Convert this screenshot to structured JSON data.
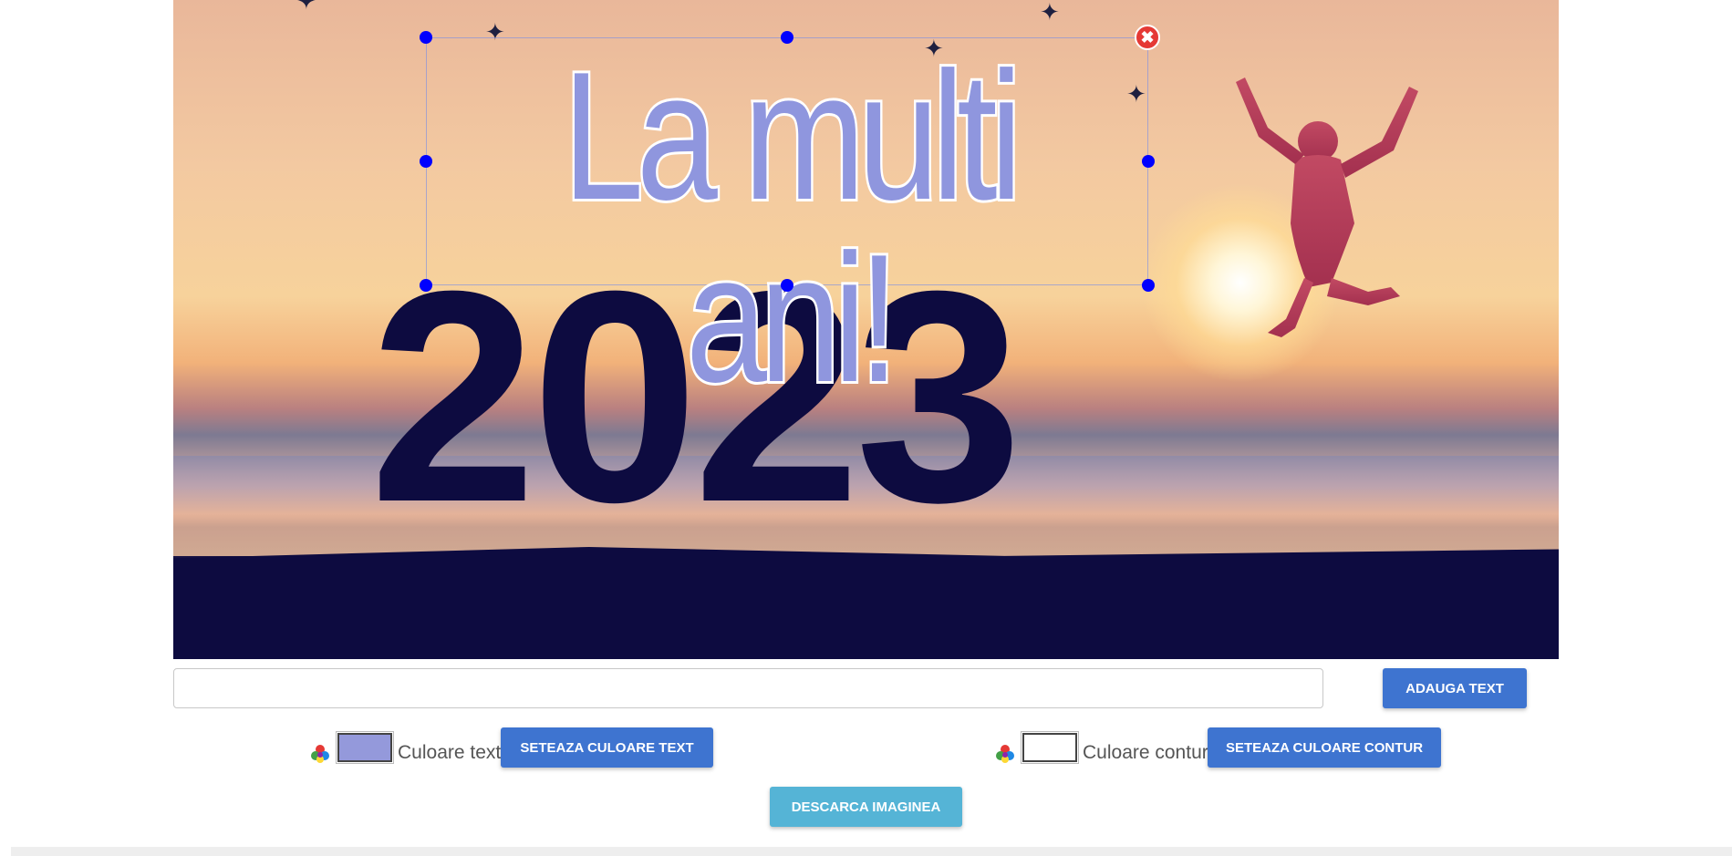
{
  "canvas": {
    "overlay_text": "La multi ani!",
    "background_text": "2023"
  },
  "editor": {
    "delete_icon": "close-icon",
    "text_input_value": "",
    "text_input_placeholder": "",
    "add_text_label": "ADAUGA TEXT"
  },
  "text_color": {
    "icon": "palette-icon",
    "swatch_color": "#9499db",
    "label": "Culoare text",
    "button_label": "SETEAZA CULOARE TEXT"
  },
  "outline_color": {
    "icon": "palette-icon",
    "swatch_color": "#ffffff",
    "label": "Culoare contur",
    "button_label": "SETEAZA CULOARE CONTUR"
  },
  "download": {
    "button_label": "DESCARCA IMAGINEA"
  },
  "colors": {
    "primary_button": "#3e74d0",
    "download_button": "#55b4d6",
    "handle": "#0000ff",
    "delete": "#e53935"
  }
}
